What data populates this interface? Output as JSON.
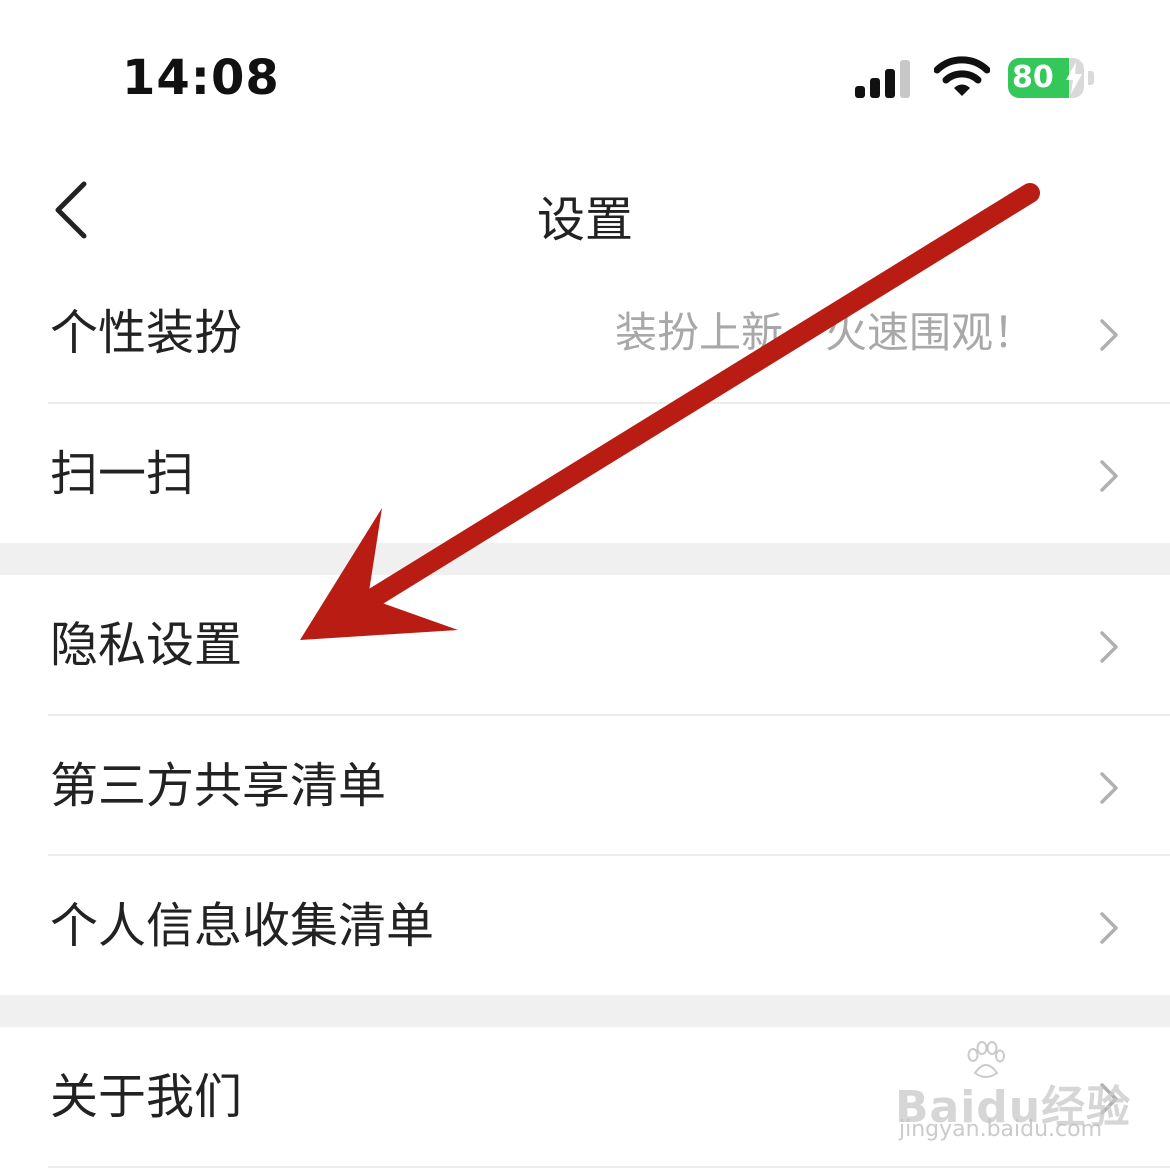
{
  "status_bar": {
    "time": "14:08",
    "battery_level": "80",
    "battery_fraction": 0.8,
    "icons": [
      "signal-icon",
      "wifi-icon",
      "battery-icon",
      "bolt-icon"
    ]
  },
  "nav": {
    "title": "设置",
    "back_icon": "chevron-left-icon"
  },
  "rows": [
    {
      "label": "个性装扮",
      "hint": "装扮上新，火速围观！"
    },
    {
      "label": "扫一扫"
    },
    {
      "label": "隐私设置"
    },
    {
      "label": "第三方共享清单"
    },
    {
      "label": "个人信息收集清单"
    },
    {
      "label": "关于我们"
    }
  ],
  "watermark": {
    "brand": "Baidu经验",
    "url": "jingyan.baidu.com"
  },
  "colors": {
    "arrow": "#b81c12",
    "battery_green": "#34c759",
    "text_primary": "#222222",
    "text_hint": "#a8a8a8",
    "section_gap": "#f0f0f0",
    "divider": "#ededed"
  }
}
